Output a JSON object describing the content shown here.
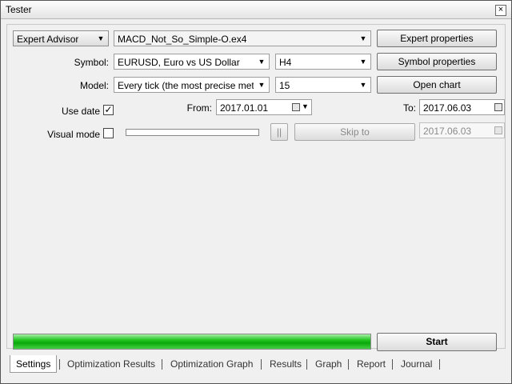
{
  "window": {
    "title": "Tester"
  },
  "settings": {
    "expert_type": "Expert Advisor",
    "expert_file": "MACD_Not_So_Simple-O.ex4",
    "symbol_label": "Symbol:",
    "symbol_value": "EURUSD, Euro vs US Dollar",
    "period_value": "H4",
    "model_label": "Model:",
    "model_value": "Every tick (the most precise method",
    "spread_value": "15",
    "use_date_label": "Use date",
    "use_date_checked": true,
    "from_label": "From:",
    "from_value": "2017.01.01",
    "to_label": "To:",
    "to_value": "2017.06.03",
    "visual_mode_label": "Visual mode",
    "visual_mode_checked": false,
    "pause_label": "||",
    "skip_to_label": "Skip to",
    "skip_to_date": "2017.06.03"
  },
  "buttons": {
    "expert_properties": "Expert properties",
    "symbol_properties": "Symbol properties",
    "open_chart": "Open chart",
    "start": "Start"
  },
  "progress": {
    "fraction": 1.0,
    "color": "#1fc41f"
  },
  "tabs": [
    "Settings",
    "Optimization Results",
    "Optimization Graph",
    "Results",
    "Graph",
    "Report",
    "Journal"
  ],
  "active_tab": "Settings"
}
